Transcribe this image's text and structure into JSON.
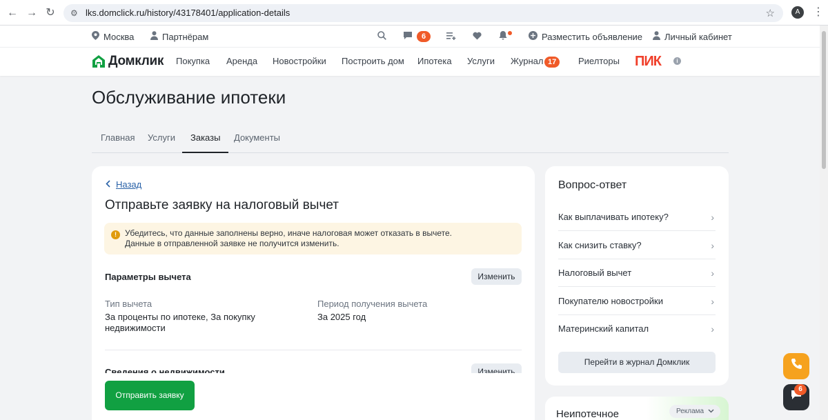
{
  "browser": {
    "url": "lks.domclick.ru/history/43178401/application-details",
    "profile_initial": "A"
  },
  "topbar": {
    "city": "Москва",
    "partners": "Партнёрам",
    "messages_count": "6",
    "post_ad": "Разместить объявление",
    "account": "Личный кабинет"
  },
  "nav": {
    "logo": "Домклик",
    "links": [
      "Покупка",
      "Аренда",
      "Новостройки",
      "Построить дом",
      "Ипотека",
      "Услуги",
      "Журнал",
      "Риелторы"
    ],
    "journal_badge": "17",
    "partner_logo": "ПИК"
  },
  "page": {
    "title": "Обслуживание ипотеки",
    "tabs": [
      "Главная",
      "Услуги",
      "Заказы",
      "Документы"
    ],
    "active_tab": "Заказы"
  },
  "form": {
    "back": "Назад",
    "title": "Отправьте заявку на налоговый вычет",
    "warning": "Убедитесь, что данные заполнены верно, иначе налоговая может отказать в вычете. Данные в отправленной заявке не получится изменить.",
    "section1_title": "Параметры вычета",
    "edit_label": "Изменить",
    "deduction_type_label": "Тип вычета",
    "deduction_type_value": "За проценты по ипотеке, За покупку недвижимости",
    "period_label": "Период получения вычета",
    "period_value": "За 2025 год",
    "section2_title": "Сведения о недвижимости",
    "submit": "Отправить заявку"
  },
  "faq": {
    "title": "Вопрос-ответ",
    "items": [
      "Как выплачивать ипотеку?",
      "Как снизить ставку?",
      "Налоговый вычет",
      "Покупателю новостройки",
      "Материнский капитал"
    ],
    "button": "Перейти в журнал Домклик"
  },
  "ad": {
    "title": "Неипотечное",
    "chip": "Реклама"
  },
  "fab": {
    "chat_badge": "6"
  },
  "colors": {
    "accent_green": "#11a042",
    "badge_orange": "#f05a28",
    "link_blue": "#2a62a8",
    "warning_bg": "#fdf5e3"
  }
}
